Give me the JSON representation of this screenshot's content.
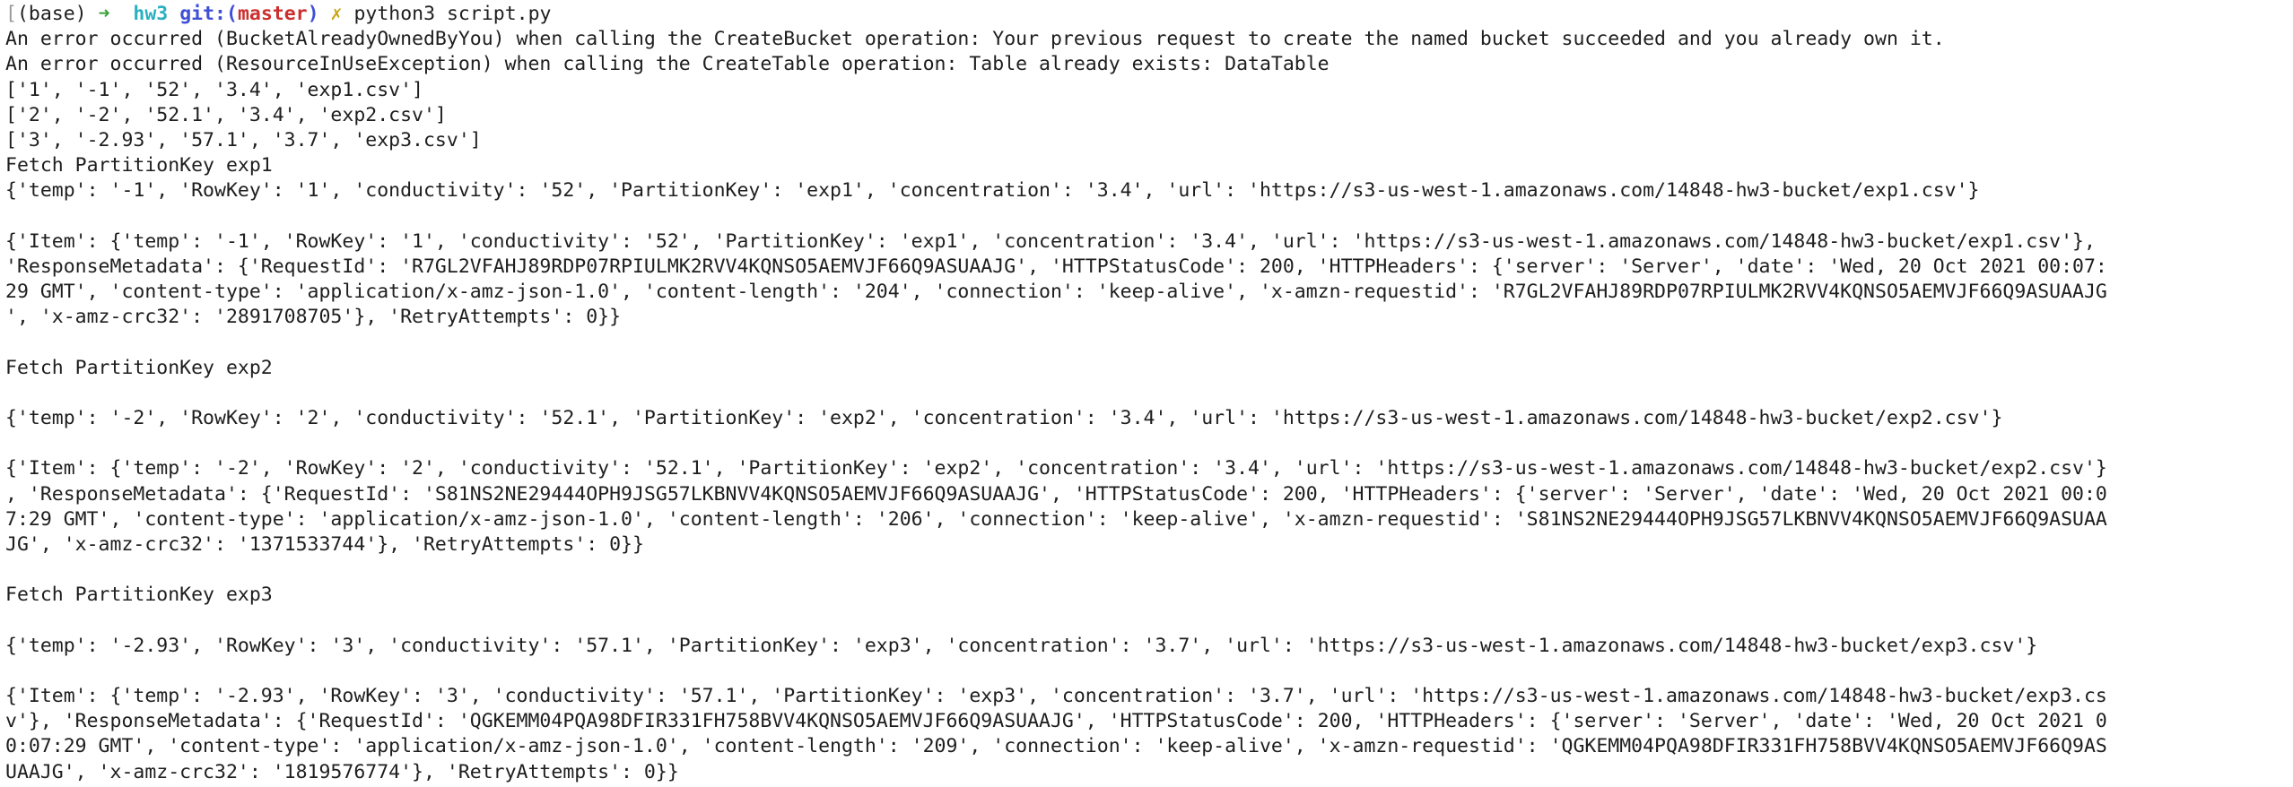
{
  "window": {
    "accent": "#1e1e1e"
  },
  "prompt": {
    "bracket": "[",
    "env": "(base)",
    "arrow": "➜",
    "dir": "hw3",
    "git_label": "git:(",
    "branch": "master",
    "git_close": ")",
    "dirty_mark": "✗",
    "command": "python3 script.py",
    "colors": {
      "arrow": "#3aa33a",
      "dir": "#2ab0c0",
      "git": "#3f4fd6",
      "branch": "#cc2f2f",
      "dirty_mark": "#c9a417"
    }
  },
  "output": [
    "An error occurred (BucketAlreadyOwnedByYou) when calling the CreateBucket operation: Your previous request to create the named bucket succeeded and you already own it.",
    "An error occurred (ResourceInUseException) when calling the CreateTable operation: Table already exists: DataTable",
    "['1', '-1', '52', '3.4', 'exp1.csv']",
    "['2', '-2', '52.1', '3.4', 'exp2.csv']",
    "['3', '-2.93', '57.1', '3.7', 'exp3.csv']",
    "Fetch PartitionKey exp1",
    "{'temp': '-1', 'RowKey': '1', 'conductivity': '52', 'PartitionKey': 'exp1', 'concentration': '3.4', 'url': 'https://s3-us-west-1.amazonaws.com/14848-hw3-bucket/exp1.csv'}",
    "",
    "{'Item': {'temp': '-1', 'RowKey': '1', 'conductivity': '52', 'PartitionKey': 'exp1', 'concentration': '3.4', 'url': 'https://s3-us-west-1.amazonaws.com/14848-hw3-bucket/exp1.csv'},",
    "'ResponseMetadata': {'RequestId': 'R7GL2VFAHJ89RDP07RPIULMK2RVV4KQNSO5AEMVJF66Q9ASUAAJG', 'HTTPStatusCode': 200, 'HTTPHeaders': {'server': 'Server', 'date': 'Wed, 20 Oct 2021 00:07:",
    "29 GMT', 'content-type': 'application/x-amz-json-1.0', 'content-length': '204', 'connection': 'keep-alive', 'x-amzn-requestid': 'R7GL2VFAHJ89RDP07RPIULMK2RVV4KQNSO5AEMVJF66Q9ASUAAJG",
    "', 'x-amz-crc32': '2891708705'}, 'RetryAttempts': 0}}",
    "",
    "Fetch PartitionKey exp2",
    "",
    "{'temp': '-2', 'RowKey': '2', 'conductivity': '52.1', 'PartitionKey': 'exp2', 'concentration': '3.4', 'url': 'https://s3-us-west-1.amazonaws.com/14848-hw3-bucket/exp2.csv'}",
    "",
    "{'Item': {'temp': '-2', 'RowKey': '2', 'conductivity': '52.1', 'PartitionKey': 'exp2', 'concentration': '3.4', 'url': 'https://s3-us-west-1.amazonaws.com/14848-hw3-bucket/exp2.csv'}",
    ", 'ResponseMetadata': {'RequestId': 'S81NS2NE29444OPH9JSG57LKBNVV4KQNSO5AEMVJF66Q9ASUAAJG', 'HTTPStatusCode': 200, 'HTTPHeaders': {'server': 'Server', 'date': 'Wed, 20 Oct 2021 00:0",
    "7:29 GMT', 'content-type': 'application/x-amz-json-1.0', 'content-length': '206', 'connection': 'keep-alive', 'x-amzn-requestid': 'S81NS2NE29444OPH9JSG57LKBNVV4KQNSO5AEMVJF66Q9ASUAA",
    "JG', 'x-amz-crc32': '1371533744'}, 'RetryAttempts': 0}}",
    "",
    "Fetch PartitionKey exp3",
    "",
    "{'temp': '-2.93', 'RowKey': '3', 'conductivity': '57.1', 'PartitionKey': 'exp3', 'concentration': '3.7', 'url': 'https://s3-us-west-1.amazonaws.com/14848-hw3-bucket/exp3.csv'}",
    "",
    "{'Item': {'temp': '-2.93', 'RowKey': '3', 'conductivity': '57.1', 'PartitionKey': 'exp3', 'concentration': '3.7', 'url': 'https://s3-us-west-1.amazonaws.com/14848-hw3-bucket/exp3.cs",
    "v'}, 'ResponseMetadata': {'RequestId': 'QGKEMM04PQA98DFIR331FH758BVV4KQNSO5AEMVJF66Q9ASUAAJG', 'HTTPStatusCode': 200, 'HTTPHeaders': {'server': 'Server', 'date': 'Wed, 20 Oct 2021 0",
    "0:07:29 GMT', 'content-type': 'application/x-amz-json-1.0', 'content-length': '209', 'connection': 'keep-alive', 'x-amzn-requestid': 'QGKEMM04PQA98DFIR331FH758BVV4KQNSO5AEMVJF66Q9AS",
    "UAAJG', 'x-amz-crc32': '1819576774'}, 'RetryAttempts': 0}}"
  ]
}
